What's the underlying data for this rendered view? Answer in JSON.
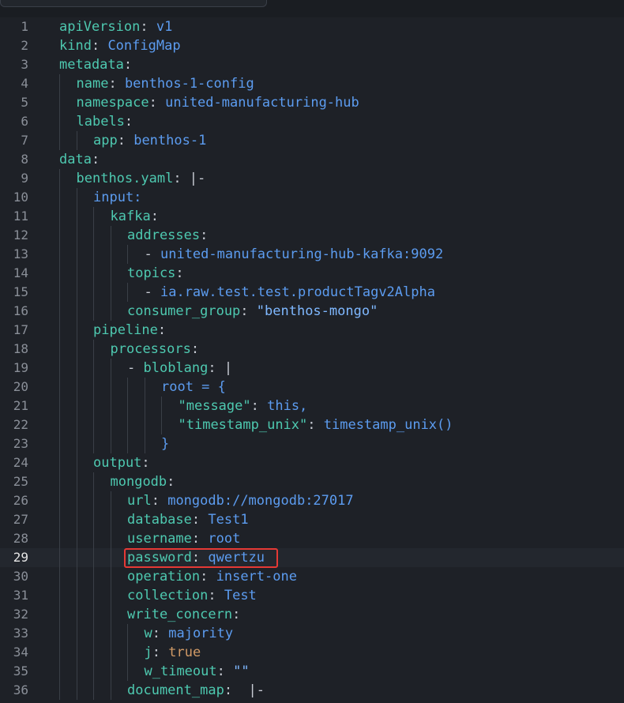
{
  "editor": {
    "language": "yaml",
    "active_line": 29,
    "highlight_color": "#e53935",
    "lines": [
      {
        "n": "1",
        "indent": 0,
        "tokens": [
          [
            "k",
            "apiVersion"
          ],
          [
            "p",
            ": "
          ],
          [
            "s",
            "v1"
          ]
        ]
      },
      {
        "n": "2",
        "indent": 0,
        "tokens": [
          [
            "k",
            "kind"
          ],
          [
            "p",
            ": "
          ],
          [
            "s",
            "ConfigMap"
          ]
        ]
      },
      {
        "n": "3",
        "indent": 0,
        "tokens": [
          [
            "k",
            "metadata"
          ],
          [
            "p",
            ":"
          ]
        ]
      },
      {
        "n": "4",
        "indent": 1,
        "tokens": [
          [
            "k",
            "name"
          ],
          [
            "p",
            ": "
          ],
          [
            "s",
            "benthos-1-config"
          ]
        ]
      },
      {
        "n": "5",
        "indent": 1,
        "tokens": [
          [
            "k",
            "namespace"
          ],
          [
            "p",
            ": "
          ],
          [
            "s",
            "united-manufacturing-hub"
          ]
        ]
      },
      {
        "n": "6",
        "indent": 1,
        "tokens": [
          [
            "k",
            "labels"
          ],
          [
            "p",
            ":"
          ]
        ]
      },
      {
        "n": "7",
        "indent": 2,
        "tokens": [
          [
            "k",
            "app"
          ],
          [
            "p",
            ": "
          ],
          [
            "s",
            "benthos-1"
          ]
        ]
      },
      {
        "n": "8",
        "indent": 0,
        "tokens": [
          [
            "k",
            "data"
          ],
          [
            "p",
            ":"
          ]
        ]
      },
      {
        "n": "9",
        "indent": 1,
        "tokens": [
          [
            "k",
            "benthos.yaml"
          ],
          [
            "p",
            ": |-"
          ]
        ]
      },
      {
        "n": "10",
        "indent": 2,
        "tokens": [
          [
            "s",
            "input:"
          ]
        ]
      },
      {
        "n": "11",
        "indent": 3,
        "tokens": [
          [
            "k",
            "kafka"
          ],
          [
            "p",
            ":"
          ]
        ]
      },
      {
        "n": "12",
        "indent": 4,
        "tokens": [
          [
            "k",
            "addresses"
          ],
          [
            "p",
            ":"
          ]
        ]
      },
      {
        "n": "13",
        "indent": 5,
        "tokens": [
          [
            "p",
            "- "
          ],
          [
            "s",
            "united-manufacturing-hub-kafka:9092"
          ]
        ]
      },
      {
        "n": "14",
        "indent": 4,
        "tokens": [
          [
            "k",
            "topics"
          ],
          [
            "p",
            ":"
          ]
        ]
      },
      {
        "n": "15",
        "indent": 5,
        "tokens": [
          [
            "p",
            "- "
          ],
          [
            "s",
            "ia.raw.test.test.productTagv2Alpha"
          ]
        ]
      },
      {
        "n": "16",
        "indent": 4,
        "tokens": [
          [
            "k",
            "consumer_group"
          ],
          [
            "p",
            ": "
          ],
          [
            "str2",
            "\"benthos-mongo\""
          ]
        ]
      },
      {
        "n": "17",
        "indent": 2,
        "tokens": [
          [
            "k",
            "pipeline"
          ],
          [
            "p",
            ":"
          ]
        ]
      },
      {
        "n": "18",
        "indent": 3,
        "tokens": [
          [
            "k",
            "processors"
          ],
          [
            "p",
            ":"
          ]
        ]
      },
      {
        "n": "19",
        "indent": 4,
        "tokens": [
          [
            "p",
            "- "
          ],
          [
            "k",
            "bloblang"
          ],
          [
            "p",
            ": |"
          ]
        ]
      },
      {
        "n": "20",
        "indent": 6,
        "tokens": [
          [
            "s",
            "root = {"
          ]
        ]
      },
      {
        "n": "21",
        "indent": 7,
        "tokens": [
          [
            "k",
            "\"message\""
          ],
          [
            "p",
            ": "
          ],
          [
            "s",
            "this,"
          ]
        ]
      },
      {
        "n": "22",
        "indent": 7,
        "tokens": [
          [
            "k",
            "\"timestamp_unix\""
          ],
          [
            "p",
            ": "
          ],
          [
            "s",
            "timestamp_unix()"
          ]
        ]
      },
      {
        "n": "23",
        "indent": 6,
        "tokens": [
          [
            "s",
            "}"
          ]
        ]
      },
      {
        "n": "24",
        "indent": 2,
        "tokens": [
          [
            "k",
            "output"
          ],
          [
            "p",
            ":"
          ]
        ]
      },
      {
        "n": "25",
        "indent": 3,
        "tokens": [
          [
            "k",
            "mongodb"
          ],
          [
            "p",
            ":"
          ]
        ]
      },
      {
        "n": "26",
        "indent": 4,
        "tokens": [
          [
            "k",
            "url"
          ],
          [
            "p",
            ": "
          ],
          [
            "s",
            "mongodb://mongodb:27017"
          ]
        ]
      },
      {
        "n": "27",
        "indent": 4,
        "tokens": [
          [
            "k",
            "database"
          ],
          [
            "p",
            ": "
          ],
          [
            "s",
            "Test1"
          ]
        ]
      },
      {
        "n": "28",
        "indent": 4,
        "tokens": [
          [
            "k",
            "username"
          ],
          [
            "p",
            ": "
          ],
          [
            "s",
            "root"
          ]
        ]
      },
      {
        "n": "29",
        "indent": 4,
        "tokens": [
          [
            "k",
            "password"
          ],
          [
            "p",
            ": "
          ],
          [
            "s",
            "qwertzu"
          ]
        ]
      },
      {
        "n": "30",
        "indent": 4,
        "tokens": [
          [
            "k",
            "operation"
          ],
          [
            "p",
            ": "
          ],
          [
            "s",
            "insert-one"
          ]
        ]
      },
      {
        "n": "31",
        "indent": 4,
        "tokens": [
          [
            "k",
            "collection"
          ],
          [
            "p",
            ": "
          ],
          [
            "s",
            "Test"
          ]
        ]
      },
      {
        "n": "32",
        "indent": 4,
        "tokens": [
          [
            "k",
            "write_concern"
          ],
          [
            "p",
            ":"
          ]
        ]
      },
      {
        "n": "33",
        "indent": 5,
        "tokens": [
          [
            "k",
            "w"
          ],
          [
            "p",
            ": "
          ],
          [
            "s",
            "majority"
          ]
        ]
      },
      {
        "n": "34",
        "indent": 5,
        "tokens": [
          [
            "k",
            "j"
          ],
          [
            "p",
            ": "
          ],
          [
            "b",
            "true"
          ]
        ]
      },
      {
        "n": "35",
        "indent": 5,
        "tokens": [
          [
            "k",
            "w_timeout"
          ],
          [
            "p",
            ": "
          ],
          [
            "str2",
            "\"\""
          ]
        ]
      },
      {
        "n": "36",
        "indent": 4,
        "tokens": [
          [
            "k",
            "document_map"
          ],
          [
            "p",
            ":  |-"
          ]
        ]
      }
    ]
  }
}
